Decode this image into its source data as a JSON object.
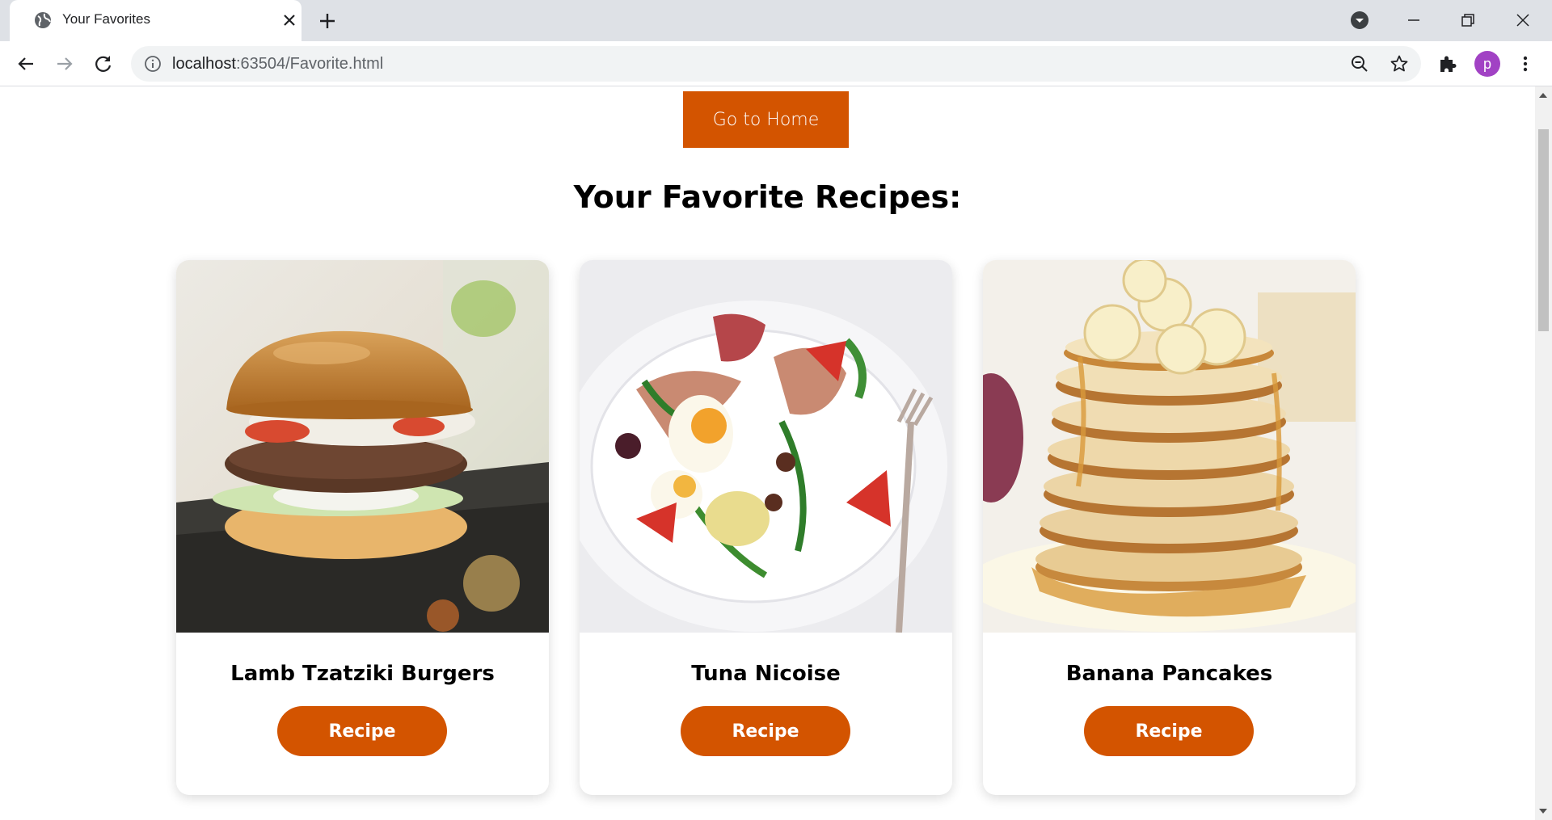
{
  "browser": {
    "tab_title": "Your Favorites",
    "url_host": "localhost",
    "url_rest": ":63504/Favorite.html",
    "profile_initial": "p"
  },
  "page": {
    "home_button": "Go to Home",
    "heading": "Your Favorite Recipes:",
    "recipes": [
      {
        "name": "Lamb Tzatziki Burgers",
        "button": "Recipe",
        "image": "burger-photo"
      },
      {
        "name": "Tuna Nicoise",
        "button": "Recipe",
        "image": "tuna-salad-photo"
      },
      {
        "name": "Banana Pancakes",
        "button": "Recipe",
        "image": "banana-pancakes-photo"
      }
    ]
  },
  "colors": {
    "accent": "#d35400",
    "tabstrip": "#dee1e6",
    "omnibox": "#f1f3f4",
    "avatar": "#a142c4"
  }
}
